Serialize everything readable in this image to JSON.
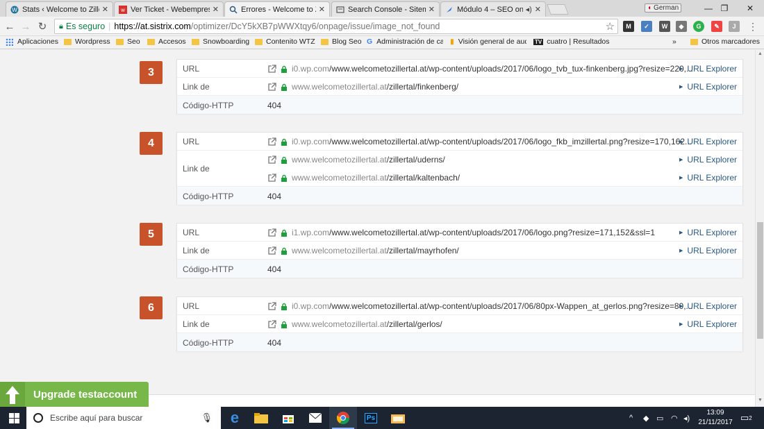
{
  "browser": {
    "tabs": [
      {
        "title": "Stats ‹ Welcome to Zillert",
        "icon": "wordpress-icon",
        "active": false
      },
      {
        "title": "Ver Ticket - Webempresa",
        "icon": "webempresa-icon",
        "active": false
      },
      {
        "title": "Errores - Welcome to Zill",
        "icon": "search-icon",
        "active": true
      },
      {
        "title": "Search Console - Sitemap",
        "icon": "search-console-icon",
        "active": false
      },
      {
        "title": "Módulo 4 – SEO on p",
        "icon": "rocket-icon",
        "active": false
      }
    ],
    "close_glyph": "✕",
    "profile_name": "German",
    "window_controls": {
      "minimize": "—",
      "restore": "❐",
      "close": "✕"
    },
    "secure_label": "Es seguro",
    "url_host": "https://at.sistrix.com",
    "url_path": "/optimizer/DcY5kXB7pWWXtqy6/onpage/issue/image_not_found",
    "bookmarks": [
      {
        "label": "Aplicaciones",
        "icon": "apps-grid-icon"
      },
      {
        "label": "Wordpress",
        "icon": "folder-icon"
      },
      {
        "label": "Seo",
        "icon": "folder-icon"
      },
      {
        "label": "Accesos",
        "icon": "folder-icon"
      },
      {
        "label": "Snowboarding",
        "icon": "folder-icon"
      },
      {
        "label": "Contenito WTZ",
        "icon": "folder-icon"
      },
      {
        "label": "Blog Seo",
        "icon": "folder-icon"
      },
      {
        "label": "Administración de ca",
        "icon": "google-icon"
      },
      {
        "label": "Visión general de aud",
        "icon": "analytics-icon"
      },
      {
        "label": "cuatro | Resultados d",
        "icon": "tv-icon"
      }
    ],
    "bookmarks_overflow": "»",
    "other_bookmarks": "Otros marcadores"
  },
  "issues": [
    {
      "number": "3",
      "url_label": "URL",
      "url_domain": "i0.wp.com",
      "url_path": "/www.welcometozillertal.at/wp-content/uploads/2017/06/logo_tvb_tux-finkenberg.jpg?resize=220,...",
      "link_label": "Link de",
      "links": [
        {
          "domain": "www.welcometozillertal.at",
          "path": "/zillertal/finkenberg/"
        }
      ],
      "http_label": "Código-HTTP",
      "http_code": "404"
    },
    {
      "number": "4",
      "url_label": "URL",
      "url_domain": "i0.wp.com",
      "url_path": "/www.welcometozillertal.at/wp-content/uploads/2017/06/logo_fkb_imzillertal.png?resize=170,162...",
      "link_label": "Link de",
      "links": [
        {
          "domain": "www.welcometozillertal.at",
          "path": "/zillertal/uderns/"
        },
        {
          "domain": "www.welcometozillertal.at",
          "path": "/zillertal/kaltenbach/"
        }
      ],
      "http_label": "Código-HTTP",
      "http_code": "404"
    },
    {
      "number": "5",
      "url_label": "URL",
      "url_domain": "i1.wp.com",
      "url_path": "/www.welcometozillertal.at/wp-content/uploads/2017/06/logo.png?resize=171,152&ssl=1",
      "link_label": "Link de",
      "links": [
        {
          "domain": "www.welcometozillertal.at",
          "path": "/zillertal/mayrhofen/"
        }
      ],
      "http_label": "Código-HTTP",
      "http_code": "404"
    },
    {
      "number": "6",
      "url_label": "URL",
      "url_domain": "i0.wp.com",
      "url_path": "/www.welcometozillertal.at/wp-content/uploads/2017/06/80px-Wappen_at_gerlos.png?resize=80,...",
      "link_label": "Link de",
      "links": [
        {
          "domain": "www.welcometozillertal.at",
          "path": "/zillertal/gerlos/"
        }
      ],
      "http_label": "Código-HTTP",
      "http_code": "404"
    }
  ],
  "explorer_label": "URL Explorer",
  "upgrade_label": "Upgrade testaccount",
  "taskbar": {
    "search_placeholder": "Escribe aquí para buscar",
    "time": "13:09",
    "date": "21/11/2017",
    "notifications": "2"
  },
  "colors": {
    "badge": "#c8522a",
    "upgrade": "#78b84a",
    "link": "#2a5885",
    "secure": "#0b8043"
  }
}
